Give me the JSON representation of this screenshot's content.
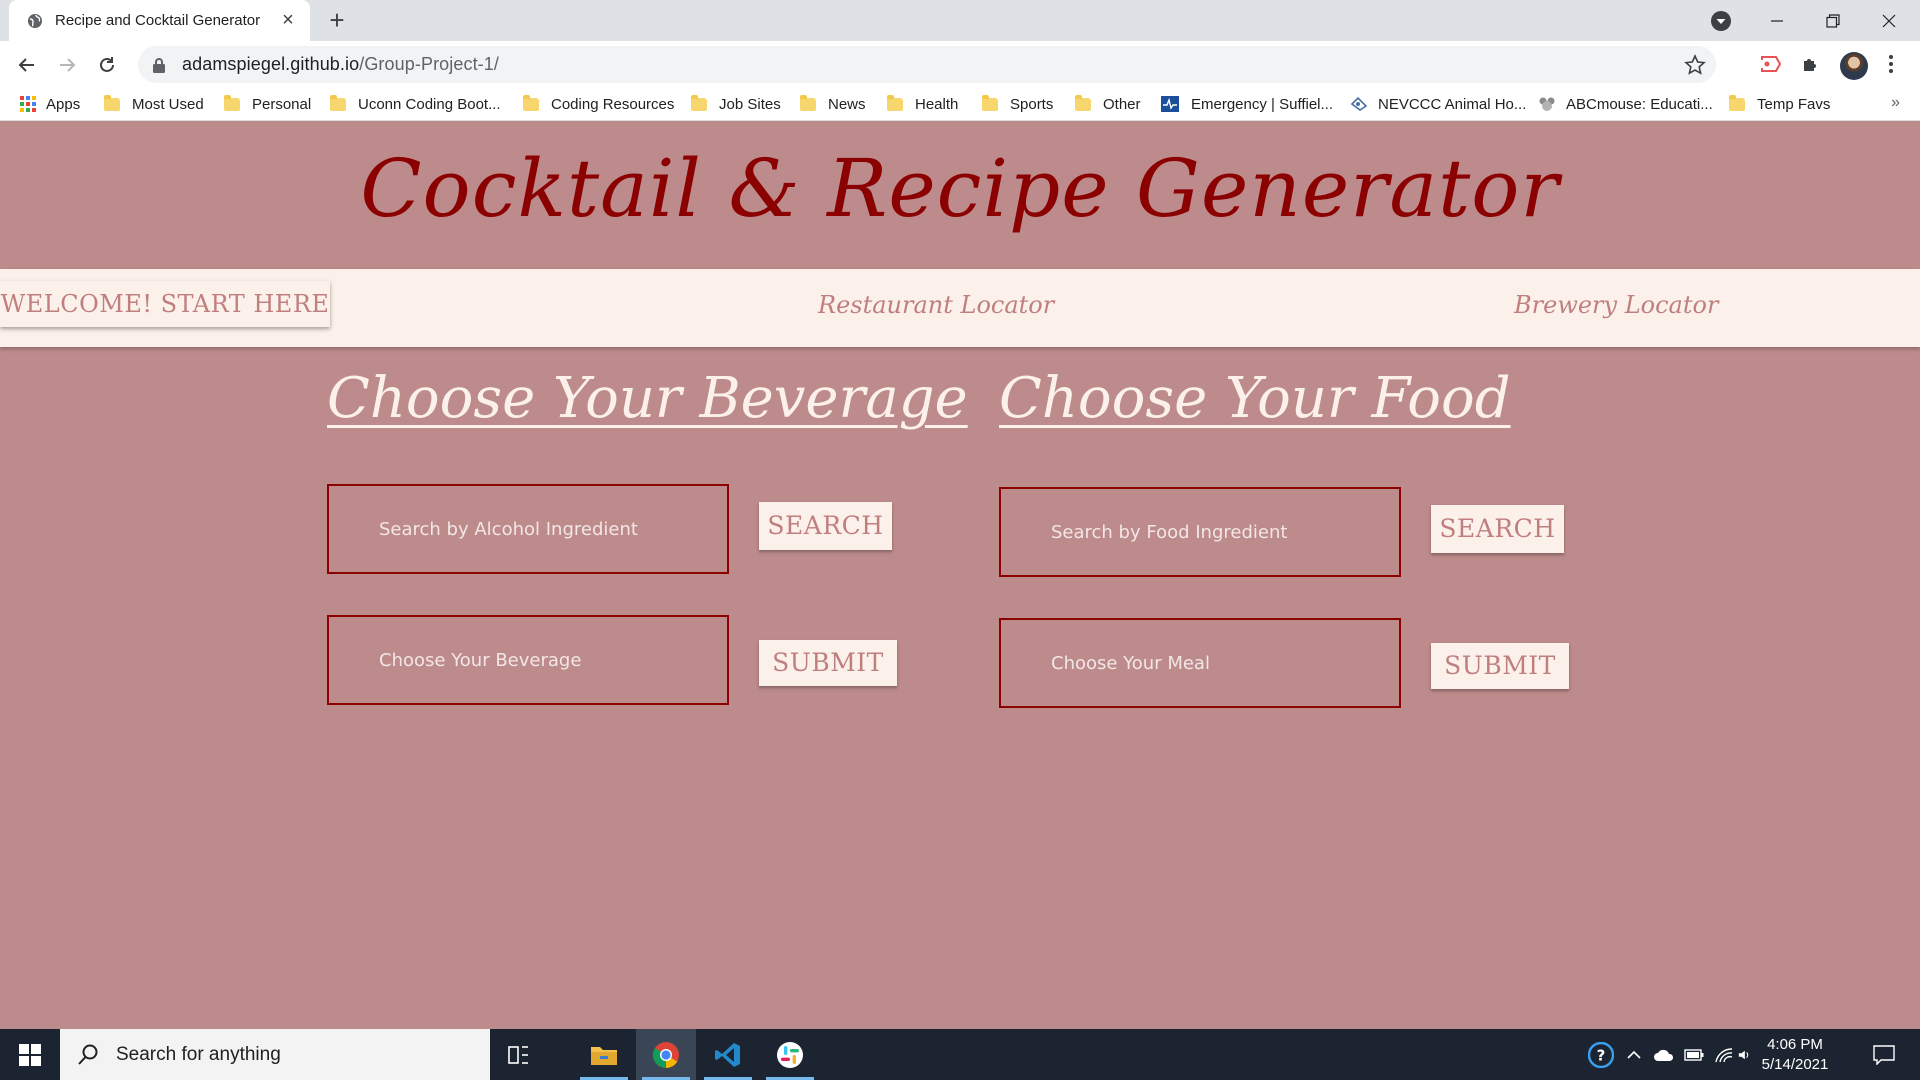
{
  "browser": {
    "tab_title": "Recipe and Cocktail Generator",
    "url_host": "adamspiegel.github.io",
    "url_path": "/Group-Project-1/",
    "bookmarks": [
      {
        "label": "Apps",
        "icon": "apps-grid-icon"
      },
      {
        "label": "Most Used",
        "icon": "folder-icon"
      },
      {
        "label": "Personal",
        "icon": "folder-icon"
      },
      {
        "label": "Uconn Coding Boot...",
        "icon": "folder-icon"
      },
      {
        "label": "Coding Resources",
        "icon": "folder-icon"
      },
      {
        "label": "Job Sites",
        "icon": "folder-icon"
      },
      {
        "label": "News",
        "icon": "folder-icon"
      },
      {
        "label": "Health",
        "icon": "folder-icon"
      },
      {
        "label": "Sports",
        "icon": "folder-icon"
      },
      {
        "label": "Other",
        "icon": "folder-icon"
      },
      {
        "label": "Emergency | Suffiel...",
        "icon": "emergency-site-icon"
      },
      {
        "label": "NEVCCC Animal Ho...",
        "icon": "paw-site-icon"
      },
      {
        "label": "ABCmouse: Educati...",
        "icon": "mouse-site-icon"
      },
      {
        "label": "Temp Favs",
        "icon": "folder-icon"
      }
    ],
    "bookmarks_overflow": "»"
  },
  "page": {
    "title": "Cocktail & Recipe Generator",
    "nav": {
      "welcome": "WELCOME! START HERE",
      "restaurant": "Restaurant Locator",
      "brewery": "Brewery Locator"
    },
    "beverage": {
      "heading": "Choose Your Beverage",
      "search_placeholder": "Search by Alcohol Ingredient",
      "search_button": "SEARCH",
      "choose_placeholder": "Choose Your Beverage",
      "submit_button": "SUBMIT"
    },
    "food": {
      "heading": "Choose Your Food",
      "search_placeholder": "Search by Food Ingredient",
      "search_button": "SEARCH",
      "choose_placeholder": "Choose Your Meal",
      "submit_button": "SUBMIT"
    },
    "colors": {
      "background": "#bd8b8b",
      "title": "#8b0000",
      "nav_bg": "#fbf1ea",
      "heading": "#fbf1ea",
      "field_border": "#8b0000"
    }
  },
  "taskbar": {
    "search_placeholder": "Search for anything",
    "time": "4:06 PM",
    "date": "5/14/2021"
  }
}
